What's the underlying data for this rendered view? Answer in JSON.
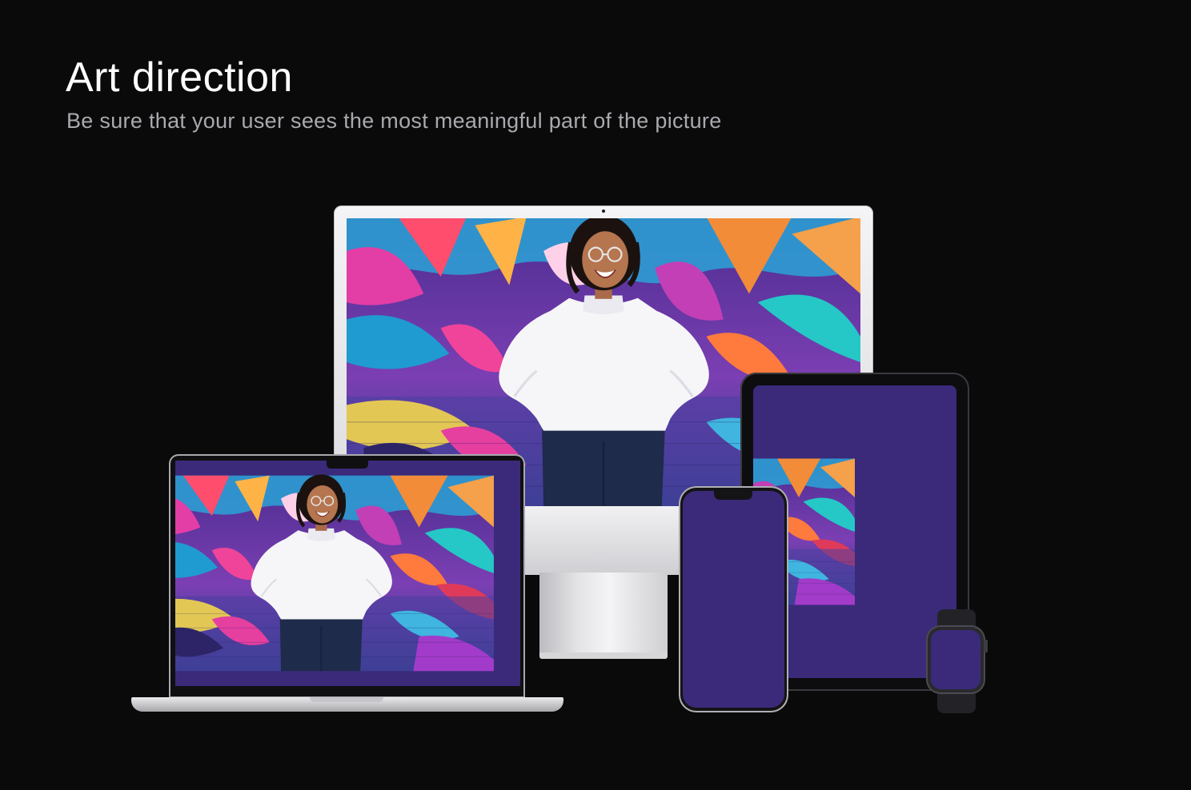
{
  "header": {
    "title": "Art direction",
    "subtitle": "Be sure that your user sees the most meaningful part of the picture"
  },
  "devices": [
    {
      "name": "desktop-monitor",
      "icon": "imac-device"
    },
    {
      "name": "tablet",
      "icon": "ipad-device"
    },
    {
      "name": "laptop",
      "icon": "macbook-device"
    },
    {
      "name": "phone",
      "icon": "iphone-device"
    },
    {
      "name": "watch",
      "icon": "apple-watch-device"
    }
  ],
  "colors": {
    "background": "#0a0a0b",
    "title": "#ffffff",
    "subtitle": "#a9a9ae",
    "device_silver": "#dcdcdf",
    "device_dark": "#101012"
  }
}
